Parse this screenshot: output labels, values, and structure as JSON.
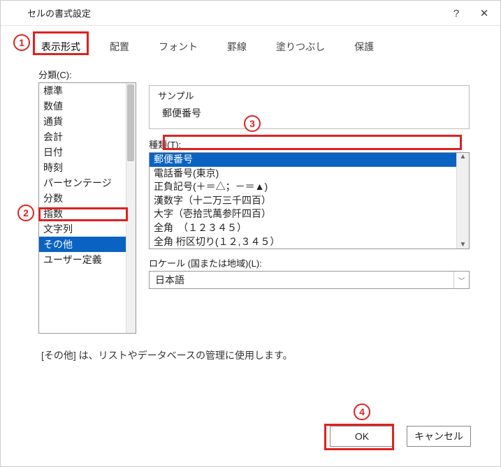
{
  "window": {
    "title": "セルの書式設定"
  },
  "tabs": {
    "format": "表示形式",
    "align": "配置",
    "font": "フォント",
    "border": "罫線",
    "fill": "塗りつぶし",
    "protect": "保護"
  },
  "labels": {
    "category": "分類(C):",
    "sample": "サンプル",
    "type": "種類(T):",
    "locale": "ロケール (国または地域)(L):"
  },
  "category_items": [
    "標準",
    "数値",
    "通貨",
    "会計",
    "日付",
    "時刻",
    "パーセンテージ",
    "分数",
    "指数",
    "文字列",
    "その他",
    "ユーザー定義"
  ],
  "category_selected_index": 10,
  "sample_value": "郵便番号",
  "type_items": [
    "郵便番号",
    "電話番号(東京)",
    "正負記号(＋＝△；－＝▲)",
    "漢数字（十二万三千四百）",
    "大字（壱拾弐萬参阡四百）",
    "全角　（１２３４５）",
    "全角 桁区切り(１２,３４５）"
  ],
  "type_selected_index": 0,
  "locale_value": "日本語",
  "description": "[その他] は、リストやデータベースの管理に使用します。",
  "buttons": {
    "ok": "OK",
    "cancel": "キャンセル"
  },
  "annotations": {
    "c1": "1",
    "c2": "2",
    "c3": "3",
    "c4": "4"
  }
}
